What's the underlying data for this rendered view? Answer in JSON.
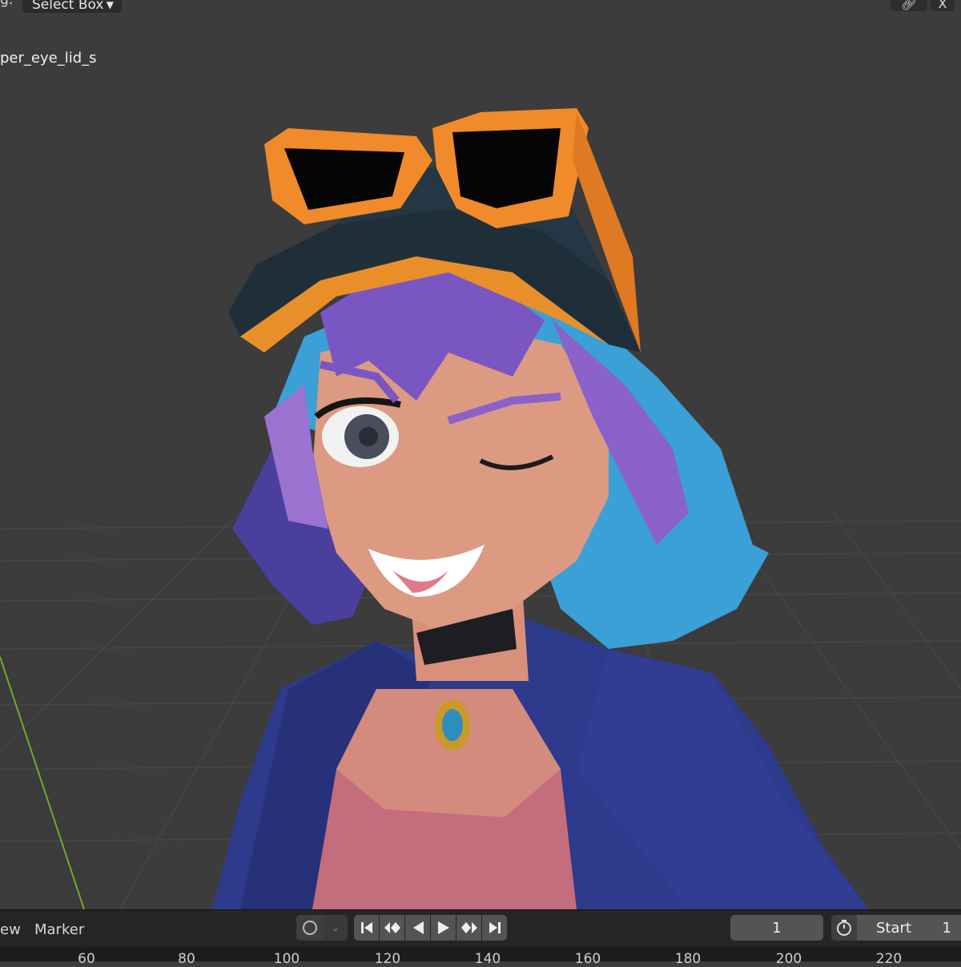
{
  "header": {
    "mode_label_fragment": "g:",
    "select_dropdown": "Select Box",
    "gizmo_icon": "link-icon",
    "close_label": "X"
  },
  "viewport": {
    "active_object": "per_eye_lid_s",
    "background_color": "#3c3c3c",
    "grid_color": "#4a4a4a",
    "y_axis_color": "#7aa82a"
  },
  "timeline": {
    "menu_view": "ew",
    "menu_marker": "Marker",
    "keying_icon": "record-circle-icon",
    "keying_dropdown_icon": "chevron-down-icon",
    "playback_icons": [
      "jump-to-start-icon",
      "previous-keyframe-icon",
      "play-reverse-icon",
      "play-icon",
      "next-keyframe-icon",
      "jump-to-end-icon"
    ],
    "current_frame": "1",
    "timer_icon": "stopwatch-icon",
    "start_label": "Start",
    "start_value": "1"
  },
  "ruler": {
    "ticks": [
      "60",
      "80",
      "100",
      "120",
      "140",
      "160",
      "180",
      "200",
      "220"
    ]
  }
}
